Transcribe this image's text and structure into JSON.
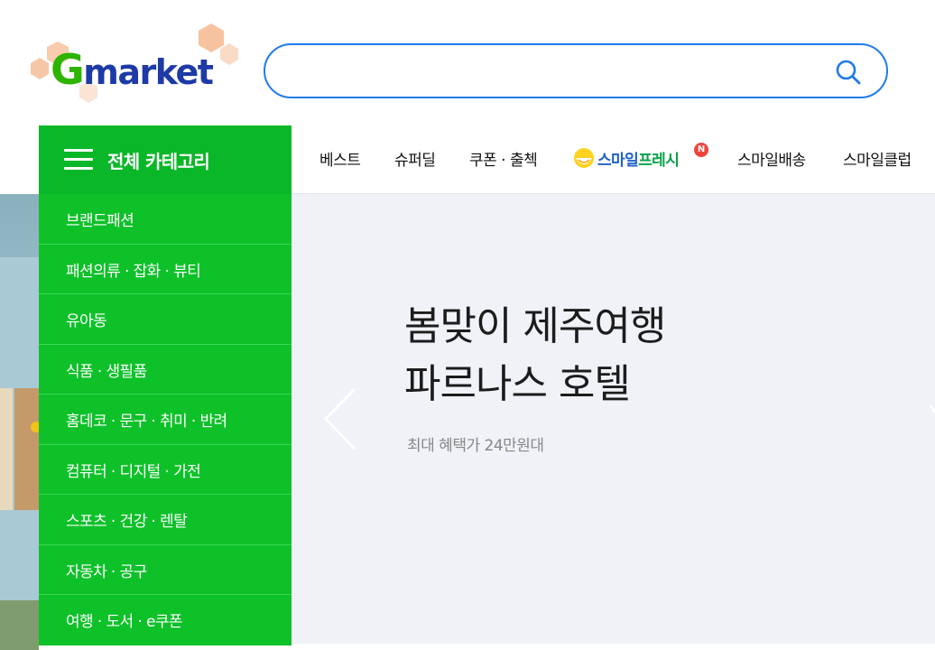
{
  "header": {
    "logo_text_g": "G",
    "logo_text_rest": "market",
    "search": {
      "value": "",
      "placeholder": ""
    }
  },
  "nav": {
    "items": [
      "베스트",
      "슈퍼딜",
      "쿠폰 · 출첵"
    ],
    "smile_fresh": {
      "part1": "스마일",
      "part2": "프레시",
      "badge": "N"
    },
    "items_after": [
      "스마일배송",
      "스마일클럽"
    ]
  },
  "category": {
    "header_label": "전체 카테고리",
    "items": [
      "브랜드패션",
      "패션의류 · 잡화 · 뷰티",
      "유아동",
      "식품 · 생필품",
      "홈데코 · 문구 · 취미 · 반려",
      "컴퓨터 · 디지털 · 가전",
      "스포츠 · 건강 · 렌탈",
      "자동차 · 공구",
      "여행 · 도서 · e쿠폰"
    ]
  },
  "hero": {
    "title_line1": "봄맞이 제주여행",
    "title_line2": "파르나스 호텔",
    "subtitle": "최대 혜택가 24만원대"
  },
  "colors": {
    "brand_green": "#0ec129",
    "search_border": "#1f7bec",
    "logo_green": "#2db400",
    "logo_blue": "#1d3aa6"
  },
  "icons": [
    "search-icon",
    "hamburger-icon",
    "chevron-left-icon",
    "smile-face-icon"
  ]
}
